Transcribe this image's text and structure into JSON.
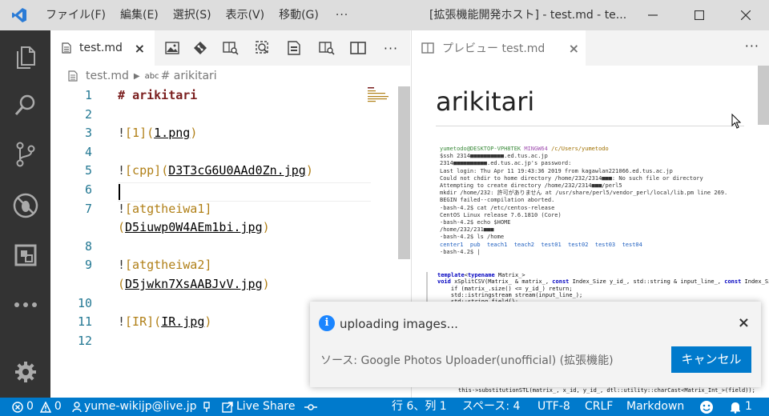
{
  "titlebar": {
    "menu": [
      "ファイル(F)",
      "編集(E)",
      "選択(S)",
      "表示(V)",
      "移動(G)"
    ],
    "more": "···",
    "title": "[拡張機能開発ホスト] - test.md - te..."
  },
  "editor": {
    "tab_label": "test.md",
    "tab_close": "×",
    "more": "···",
    "breadcrumb": {
      "file": "test.md",
      "symbol_kind": "abc",
      "symbol": "# arikitari"
    },
    "lines": [
      {
        "n": "1",
        "segments": [
          {
            "t": "# ",
            "c": "c-hash"
          },
          {
            "t": "arikitari",
            "c": "c-heading"
          }
        ]
      },
      {
        "n": "2",
        "segments": []
      },
      {
        "n": "3",
        "segments": [
          {
            "t": "!",
            "c": "c-bang"
          },
          {
            "t": "[1]",
            "c": "c-bracket"
          },
          {
            "t": "(",
            "c": "c-paren"
          },
          {
            "t": "1.png",
            "c": "c-url"
          },
          {
            "t": ")",
            "c": "c-paren"
          }
        ]
      },
      {
        "n": "4",
        "segments": []
      },
      {
        "n": "5",
        "segments": [
          {
            "t": "!",
            "c": "c-bang"
          },
          {
            "t": "[cpp]",
            "c": "c-bracket"
          },
          {
            "t": "(",
            "c": "c-paren"
          },
          {
            "t": "D3T3cG6U0AAd0Zn.jpg",
            "c": "c-url"
          },
          {
            "t": ")",
            "c": "c-paren"
          }
        ]
      },
      {
        "n": "6",
        "segments": []
      },
      {
        "n": "7",
        "segments": [
          {
            "t": "!",
            "c": "c-bang"
          },
          {
            "t": "[atgtheiwa1]",
            "c": "c-bracket"
          }
        ]
      },
      {
        "n": "",
        "segments": [
          {
            "t": "(",
            "c": "c-paren"
          },
          {
            "t": "D5iuwp0W4AEm1bi.jpg",
            "c": "c-url"
          },
          {
            "t": ")",
            "c": "c-paren"
          }
        ]
      },
      {
        "n": "8",
        "segments": []
      },
      {
        "n": "9",
        "segments": [
          {
            "t": "!",
            "c": "c-bang"
          },
          {
            "t": "[atgtheiwa2]",
            "c": "c-bracket"
          }
        ]
      },
      {
        "n": "",
        "segments": [
          {
            "t": "(",
            "c": "c-paren"
          },
          {
            "t": "D5jwkn7XsAABJvV.jpg",
            "c": "c-url"
          },
          {
            "t": ")",
            "c": "c-paren"
          }
        ]
      },
      {
        "n": "10",
        "segments": []
      },
      {
        "n": "11",
        "segments": [
          {
            "t": "!",
            "c": "c-bang"
          },
          {
            "t": "[IR]",
            "c": "c-bracket"
          },
          {
            "t": "(",
            "c": "c-paren"
          },
          {
            "t": "IR.jpg",
            "c": "c-url"
          },
          {
            "t": ")",
            "c": "c-paren"
          }
        ]
      },
      {
        "n": "12",
        "segments": []
      }
    ]
  },
  "preview": {
    "tab_label": "プレビュー test.md",
    "tab_close": "×",
    "more": "···",
    "heading": "arikitari",
    "terminal": [
      [
        {
          "t": "yumetodo@DESKTOP-VPH8TEK ",
          "c": "g"
        },
        {
          "t": "MINGW64",
          "c": "m"
        },
        {
          "t": " /c/Users/yumetodo",
          "c": "y"
        }
      ],
      [
        {
          "t": "$ssh 2314■■■■■■■■■■.ed.tus.ac.jp",
          "c": ""
        }
      ],
      [
        {
          "t": "2314■■■■■■■■■■.ed.tus.ac.jp's password:",
          "c": ""
        }
      ],
      [
        {
          "t": "Last login: Thu Apr 11 19:43:36 2019 from kagawlan221066.ed.tus.ac.jp",
          "c": ""
        }
      ],
      [
        {
          "t": "Could not chdir to home directory /home/232/2314■■■: No such file or directory",
          "c": ""
        }
      ],
      [
        {
          "t": "Attempting to create directory /home/232/2314■■■/perl5",
          "c": ""
        }
      ],
      [
        {
          "t": "mkdir /home/232: 許可がありません at /usr/share/perl5/vendor_perl/local/lib.pm line 269.",
          "c": ""
        }
      ],
      [
        {
          "t": "BEGIN failed--compilation aborted.",
          "c": ""
        }
      ],
      [
        {
          "t": "-bash-4.2$ cat /etc/centos-release",
          "c": ""
        }
      ],
      [
        {
          "t": "CentOS Linux release 7.6.1810 (Core)",
          "c": ""
        }
      ],
      [
        {
          "t": "-bash-4.2$ echo $HOME",
          "c": ""
        }
      ],
      [
        {
          "t": "/home/232/231■■■",
          "c": ""
        }
      ],
      [
        {
          "t": "-bash-4.2$ ls /home",
          "c": ""
        }
      ],
      [
        {
          "t": "center1  pub  teach1  teach2  test01  test02  test03  test04",
          "c": "b"
        }
      ],
      [
        {
          "t": "-bash-4.2$ |",
          "c": ""
        }
      ]
    ],
    "code": [
      [
        {
          "t": "template",
          "c": "kw"
        },
        {
          "t": "<",
          "c": ""
        },
        {
          "t": "typename",
          "c": "kw"
        },
        {
          "t": " Matrix_>",
          "c": ""
        }
      ],
      [
        {
          "t": "void",
          "c": "kw"
        },
        {
          "t": " xSplitCSV(Matrix_ & matrix_, ",
          "c": ""
        },
        {
          "t": "const",
          "c": "kw"
        },
        {
          "t": " Index_Size y_id_, std::string & input_line_, ",
          "c": ""
        },
        {
          "t": "const",
          "c": "kw"
        },
        {
          "t": " Index_Size layer_)",
          "c": ""
        }
      ],
      [
        {
          "t": "    if (matrix_.size() <= y_id_) return;",
          "c": ""
        }
      ],
      [
        {
          "t": "    std::istringstream stream(input_line_);",
          "c": ""
        }
      ],
      [
        {
          "t": "    std::string field{};",
          "c": ""
        }
      ]
    ],
    "bottom_code": "this->substitutionSTL(matrix_, x_id, y_id_, dtl::utility::charCast<Matrix_Int_>(field));"
  },
  "notification": {
    "message": "uploading images...",
    "close": "×",
    "source": "ソース: Google Photos Uploader(unofficial) (拡張機能)",
    "cancel_label": "キャンセル",
    "info_glyph": "i"
  },
  "statusbar": {
    "errors": "0",
    "warnings": "0",
    "account": "yume-wikijp@live.jp",
    "live_share": "Live Share",
    "position": "行 6、列 1",
    "spaces": "スペース: 4",
    "encoding": "UTF-8",
    "eol": "CRLF",
    "language": "Markdown",
    "notifications": "1"
  },
  "colors": {
    "accent": "#007acc",
    "activitybar": "#333333",
    "titlebar": "#dddddd"
  }
}
